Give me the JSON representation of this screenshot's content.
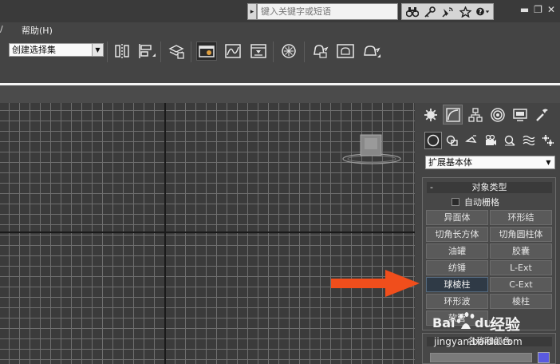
{
  "titlebar": {
    "search_placeholder": "键入关键字或短语",
    "icons": [
      "binoculars-icon",
      "key-icon",
      "satellite-icon",
      "star-icon",
      "help-icon"
    ],
    "window_controls": [
      "minimize-icon",
      "restore-icon",
      "close-icon"
    ]
  },
  "menubar": {
    "edge_label": "/",
    "help": "帮助(H)"
  },
  "toolbar": {
    "selection_set": "创建选择集",
    "icons": [
      "mirror-icon",
      "align-icon",
      "layer-manager-icon",
      "scene-explorer-icon",
      "curve-editor-icon",
      "schematic-view-icon",
      "material-editor-icon",
      "render-setup-icon",
      "rendered-frame-icon",
      "render-icon"
    ]
  },
  "command_panel": {
    "tabs": [
      "create-tab",
      "modify-tab",
      "hierarchy-tab",
      "motion-tab",
      "display-tab",
      "utilities-tab"
    ],
    "subtabs": [
      "geometry-icon",
      "shapes-icon",
      "lights-icon",
      "cameras-icon",
      "helpers-icon",
      "spacewarps-icon",
      "systems-icon"
    ],
    "category": "扩展基本体",
    "rollout_title": "对象类型",
    "rollout_minus": "-",
    "autogrid_label": "自动栅格",
    "buttons": [
      {
        "label": "异面体",
        "selected": false
      },
      {
        "label": "环形结",
        "selected": false
      },
      {
        "label": "切角长方体",
        "selected": false
      },
      {
        "label": "切角圆柱体",
        "selected": false
      },
      {
        "label": "油罐",
        "selected": false
      },
      {
        "label": "胶囊",
        "selected": false
      },
      {
        "label": "纺锤",
        "selected": false
      },
      {
        "label": "L-Ext",
        "selected": false
      },
      {
        "label": "球棱柱",
        "selected": true
      },
      {
        "label": "C-Ext",
        "selected": false
      },
      {
        "label": "环形波",
        "selected": false
      },
      {
        "label": "棱柱",
        "selected": false
      },
      {
        "label": "软管",
        "selected": false
      }
    ],
    "name_color_title": "名称和颜色",
    "swatch_color": "#5a5ae0"
  },
  "viewport": {
    "grid_color": "#6f6f6f",
    "background": "#3b3b3b"
  },
  "annotation": {
    "arrow_color": "#f04e1c"
  },
  "watermark": {
    "brand": "经验",
    "url": "jingyan.baidu.com",
    "logo_text": "Bai du"
  }
}
